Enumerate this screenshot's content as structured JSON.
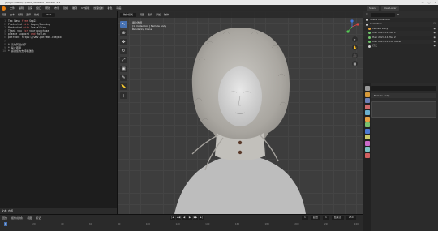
{
  "titlebar": {
    "text": "[1/2] C:\\Users\\…\\hood_fur.blend - Blender 4.1",
    "controls": [
      "—",
      "▢",
      "✕"
    ]
  },
  "menubar": {
    "items": [
      "文件",
      "编辑",
      "渲染",
      "窗口",
      "帮助",
      "布局",
      "建模",
      "雕刻",
      "UV编辑",
      "纹理绘制",
      "着色",
      "动画"
    ],
    "scene": "Scene",
    "view_layer": "ViewLayer"
  },
  "text_editor": {
    "header_items": [
      "视图",
      "文本",
      "编辑",
      "选择",
      "格式"
    ],
    "filename": "Text",
    "lines": [
      {
        "n": "1",
        "t": "Tex Mask ",
        "h": "free",
        "t2": " Sep22"
      },
      {
        "n": "2",
        "t": "Protected ",
        "h": "with",
        "t2": " Login/Banking"
      },
      {
        "n": "3",
        "t": "Protected ",
        "h": "with",
        "t2": " Installing"
      },
      {
        "n": "4",
        "t": "Thank you ",
        "h": "for",
        "t2": " your purchase"
      },
      {
        "n": "5",
        "t": "please support ",
        "h": "and",
        "t2": " follow"
      },
      {
        "n": "6",
        "t": "patreon: https://www.patreon.com/xxx",
        "h": "",
        "t2": ""
      },
      {
        "n": "7",
        "t": "",
        "h": "",
        "t2": ""
      },
      {
        "n": "8",
        "t": "* 请勿转载分享",
        "h": "",
        "t2": ""
      },
      {
        "n": "9",
        "t": "* 禁止商用",
        "h": "",
        "t2": ""
      },
      {
        "n": "10",
        "t": "* 感谢您的支持和鼓励",
        "h": "",
        "t2": ""
      }
    ],
    "footer": "文本: 内部"
  },
  "viewport": {
    "header_items": [
      "物体模式",
      "视图",
      "选择",
      "添加",
      "物体"
    ],
    "info": [
      "用户透视",
      "(1) Collection | Female body",
      "Rendering Done"
    ],
    "tools": [
      "⊕",
      "↖",
      "✥",
      "↻",
      "⤢",
      "▣",
      "✎",
      "📏",
      "＋"
    ]
  },
  "outliner": {
    "rows": [
      {
        "label": "Scene Collection",
        "color": "#cfcfcf",
        "vis": ""
      },
      {
        "label": "Collection",
        "color": "#cfcfcf",
        "vis": "☑"
      },
      {
        "label": "Female body",
        "color": "#e8a23a",
        "vis": "◉"
      },
      {
        "label": "Hair 2024-11 Har 1",
        "color": "#71c46b",
        "vis": "◉"
      },
      {
        "label": "Hair 2024-11 Har 2",
        "color": "#71c46b",
        "vis": "◉"
      },
      {
        "label": "Hair 2024-11 Cut Hairst",
        "color": "#71c46b",
        "vis": "◉"
      },
      {
        "label": "灯光",
        "color": "#cfcfcf",
        "vis": "◉"
      }
    ]
  },
  "properties": {
    "object_name": "Female body",
    "tab_colors": [
      "#9a9a9a",
      "#d79a3a",
      "#6c7fb5",
      "#cf6a6a",
      "#6ab0cf",
      "#e6a142",
      "#79c16e",
      "#4b78d1",
      "#c9c96b",
      "#c96bc9",
      "#7cc4c4",
      "#d06060"
    ]
  },
  "timeline": {
    "header_items": [
      "回放",
      "抠像(插帧)",
      "视图",
      "标记"
    ],
    "play_buttons": [
      "|◀",
      "◀◀",
      "◀",
      "▶",
      "▶▶",
      "▶|"
    ],
    "current_frame": "1",
    "start_label": "起始",
    "start": "1",
    "end_label": "结束点",
    "end": "250",
    "ruler": [
      "0",
      "20",
      "40",
      "60",
      "80",
      "100",
      "120",
      "140",
      "160",
      "180",
      "200",
      "220",
      "240"
    ]
  }
}
